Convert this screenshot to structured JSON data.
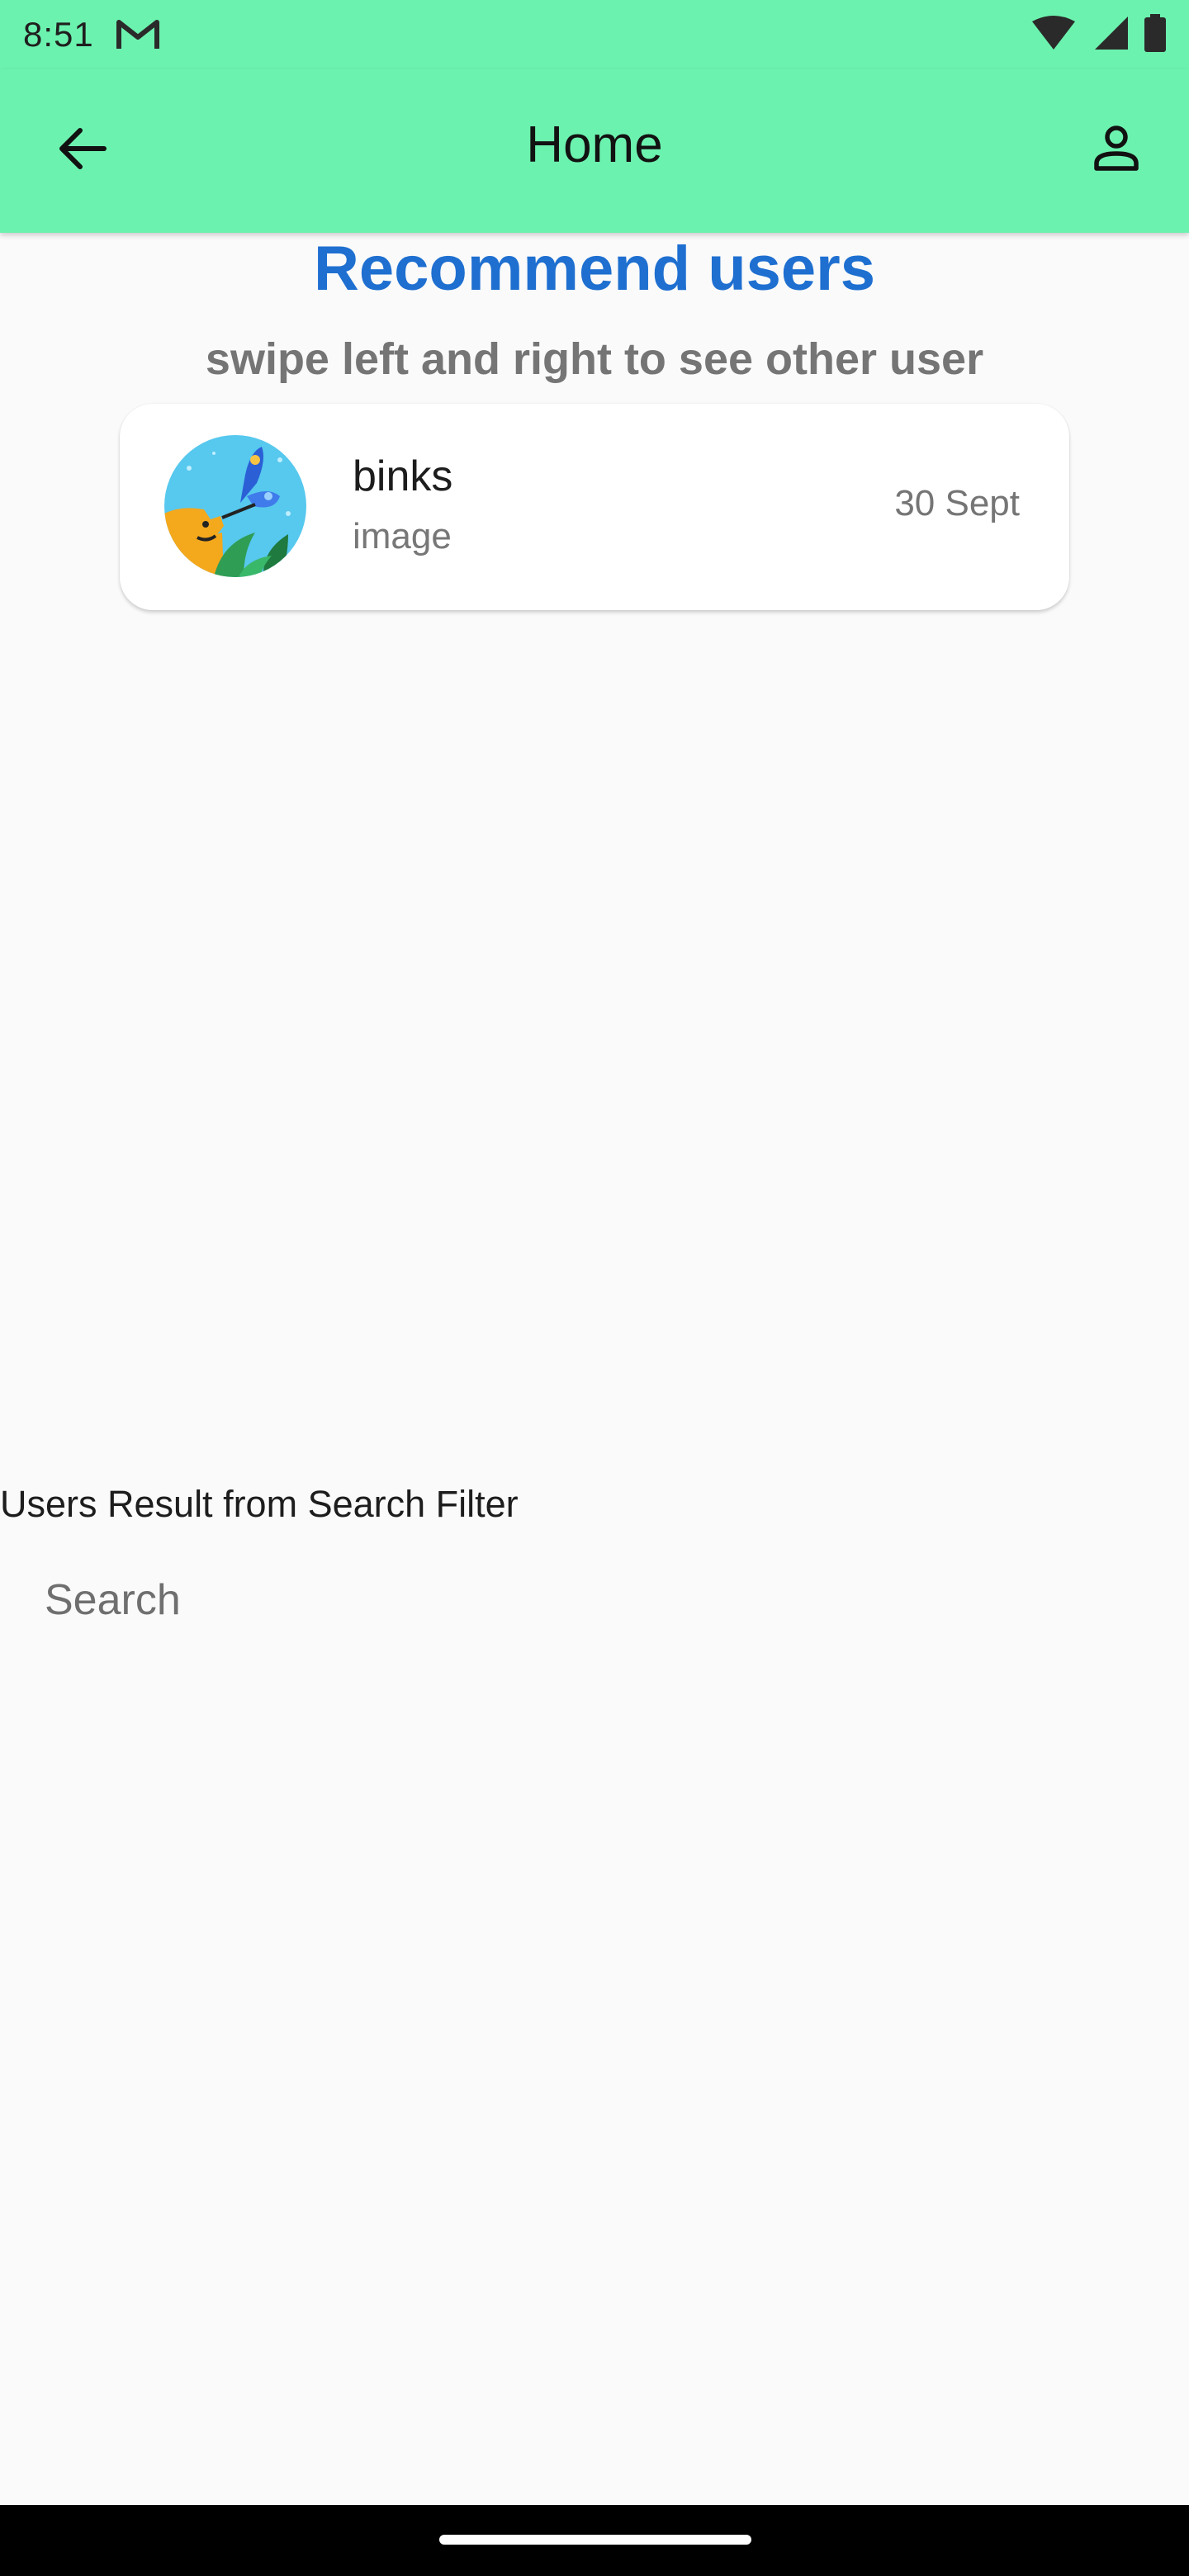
{
  "status_bar": {
    "time": "8:51",
    "notification_icons": [
      "gmail-icon"
    ],
    "system_icons": [
      "wifi-icon",
      "signal-icon",
      "battery-icon"
    ]
  },
  "app_bar": {
    "title": "Home",
    "back_icon": "arrow-left-icon",
    "profile_icon": "person-icon",
    "background_color": "#6cf2af"
  },
  "recommend": {
    "title": "Recommend users",
    "subtitle": "swipe left and right to see other user",
    "title_color": "#1e6fd0",
    "card": {
      "name": "binks",
      "subtitle": "image",
      "date": "30 Sept",
      "avatar_icon": "butterfly-avatar-icon"
    }
  },
  "search_section": {
    "label": "Users Result from Search Filter",
    "search_placeholder": "Search",
    "search_value": ""
  }
}
